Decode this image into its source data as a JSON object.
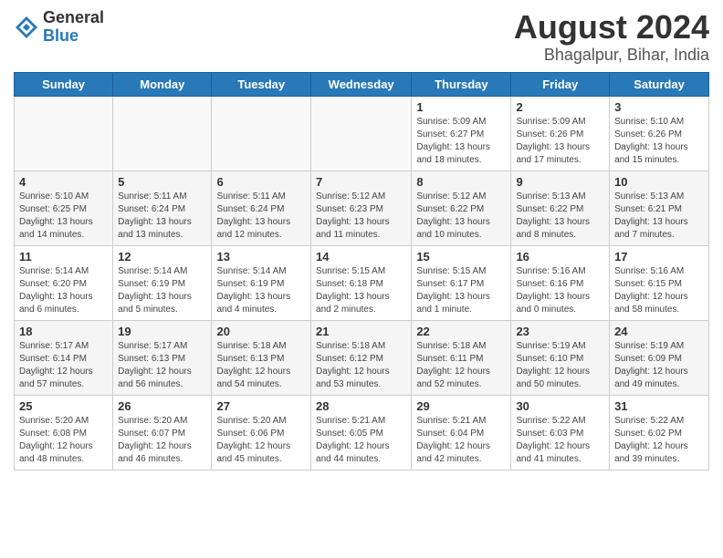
{
  "logo": {
    "general": "General",
    "blue": "Blue"
  },
  "title": "August 2024",
  "location": "Bhagalpur, Bihar, India",
  "weekdays": [
    "Sunday",
    "Monday",
    "Tuesday",
    "Wednesday",
    "Thursday",
    "Friday",
    "Saturday"
  ],
  "weeks": [
    [
      {
        "day": "",
        "info": ""
      },
      {
        "day": "",
        "info": ""
      },
      {
        "day": "",
        "info": ""
      },
      {
        "day": "",
        "info": ""
      },
      {
        "day": "1",
        "info": "Sunrise: 5:09 AM\nSunset: 6:27 PM\nDaylight: 13 hours\nand 18 minutes."
      },
      {
        "day": "2",
        "info": "Sunrise: 5:09 AM\nSunset: 6:26 PM\nDaylight: 13 hours\nand 17 minutes."
      },
      {
        "day": "3",
        "info": "Sunrise: 5:10 AM\nSunset: 6:26 PM\nDaylight: 13 hours\nand 15 minutes."
      }
    ],
    [
      {
        "day": "4",
        "info": "Sunrise: 5:10 AM\nSunset: 6:25 PM\nDaylight: 13 hours\nand 14 minutes."
      },
      {
        "day": "5",
        "info": "Sunrise: 5:11 AM\nSunset: 6:24 PM\nDaylight: 13 hours\nand 13 minutes."
      },
      {
        "day": "6",
        "info": "Sunrise: 5:11 AM\nSunset: 6:24 PM\nDaylight: 13 hours\nand 12 minutes."
      },
      {
        "day": "7",
        "info": "Sunrise: 5:12 AM\nSunset: 6:23 PM\nDaylight: 13 hours\nand 11 minutes."
      },
      {
        "day": "8",
        "info": "Sunrise: 5:12 AM\nSunset: 6:22 PM\nDaylight: 13 hours\nand 10 minutes."
      },
      {
        "day": "9",
        "info": "Sunrise: 5:13 AM\nSunset: 6:22 PM\nDaylight: 13 hours\nand 8 minutes."
      },
      {
        "day": "10",
        "info": "Sunrise: 5:13 AM\nSunset: 6:21 PM\nDaylight: 13 hours\nand 7 minutes."
      }
    ],
    [
      {
        "day": "11",
        "info": "Sunrise: 5:14 AM\nSunset: 6:20 PM\nDaylight: 13 hours\nand 6 minutes."
      },
      {
        "day": "12",
        "info": "Sunrise: 5:14 AM\nSunset: 6:19 PM\nDaylight: 13 hours\nand 5 minutes."
      },
      {
        "day": "13",
        "info": "Sunrise: 5:14 AM\nSunset: 6:19 PM\nDaylight: 13 hours\nand 4 minutes."
      },
      {
        "day": "14",
        "info": "Sunrise: 5:15 AM\nSunset: 6:18 PM\nDaylight: 13 hours\nand 2 minutes."
      },
      {
        "day": "15",
        "info": "Sunrise: 5:15 AM\nSunset: 6:17 PM\nDaylight: 13 hours\nand 1 minute."
      },
      {
        "day": "16",
        "info": "Sunrise: 5:16 AM\nSunset: 6:16 PM\nDaylight: 13 hours\nand 0 minutes."
      },
      {
        "day": "17",
        "info": "Sunrise: 5:16 AM\nSunset: 6:15 PM\nDaylight: 12 hours\nand 58 minutes."
      }
    ],
    [
      {
        "day": "18",
        "info": "Sunrise: 5:17 AM\nSunset: 6:14 PM\nDaylight: 12 hours\nand 57 minutes."
      },
      {
        "day": "19",
        "info": "Sunrise: 5:17 AM\nSunset: 6:13 PM\nDaylight: 12 hours\nand 56 minutes."
      },
      {
        "day": "20",
        "info": "Sunrise: 5:18 AM\nSunset: 6:13 PM\nDaylight: 12 hours\nand 54 minutes."
      },
      {
        "day": "21",
        "info": "Sunrise: 5:18 AM\nSunset: 6:12 PM\nDaylight: 12 hours\nand 53 minutes."
      },
      {
        "day": "22",
        "info": "Sunrise: 5:18 AM\nSunset: 6:11 PM\nDaylight: 12 hours\nand 52 minutes."
      },
      {
        "day": "23",
        "info": "Sunrise: 5:19 AM\nSunset: 6:10 PM\nDaylight: 12 hours\nand 50 minutes."
      },
      {
        "day": "24",
        "info": "Sunrise: 5:19 AM\nSunset: 6:09 PM\nDaylight: 12 hours\nand 49 minutes."
      }
    ],
    [
      {
        "day": "25",
        "info": "Sunrise: 5:20 AM\nSunset: 6:08 PM\nDaylight: 12 hours\nand 48 minutes."
      },
      {
        "day": "26",
        "info": "Sunrise: 5:20 AM\nSunset: 6:07 PM\nDaylight: 12 hours\nand 46 minutes."
      },
      {
        "day": "27",
        "info": "Sunrise: 5:20 AM\nSunset: 6:06 PM\nDaylight: 12 hours\nand 45 minutes."
      },
      {
        "day": "28",
        "info": "Sunrise: 5:21 AM\nSunset: 6:05 PM\nDaylight: 12 hours\nand 44 minutes."
      },
      {
        "day": "29",
        "info": "Sunrise: 5:21 AM\nSunset: 6:04 PM\nDaylight: 12 hours\nand 42 minutes."
      },
      {
        "day": "30",
        "info": "Sunrise: 5:22 AM\nSunset: 6:03 PM\nDaylight: 12 hours\nand 41 minutes."
      },
      {
        "day": "31",
        "info": "Sunrise: 5:22 AM\nSunset: 6:02 PM\nDaylight: 12 hours\nand 39 minutes."
      }
    ]
  ]
}
